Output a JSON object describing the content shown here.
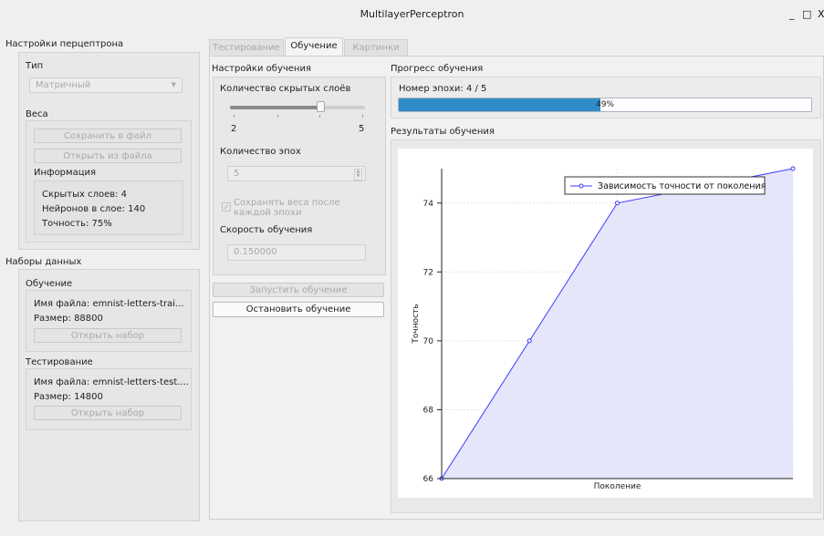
{
  "window": {
    "title": "MultilayerPerceptron",
    "minimize": "_",
    "maximize": "□",
    "close": "X"
  },
  "perceptron_settings": {
    "group_title": "Настройки перцептрона",
    "type_label": "Тип",
    "type_value": "Матричный",
    "weights_label": "Веса",
    "save_button": "Сохранить в файл",
    "open_button": "Открыть из файла",
    "info_label": "Информация",
    "hidden_layers": "Скрытых слоев:  4",
    "neurons": "Нейронов в слое:  140",
    "accuracy": "Точность:  75%"
  },
  "datasets": {
    "group_title": "Наборы данных",
    "training": {
      "label": "Обучение",
      "file": "Имя файла:  emnist-letters-trai...",
      "size": "Размер:  88800",
      "open_button": "Открыть набор"
    },
    "testing": {
      "label": "Тестирование",
      "file": "Имя файла:  emnist-letters-test....",
      "size": "Размер:  14800",
      "open_button": "Открыть набор"
    }
  },
  "tabs": [
    "Тестирование",
    "Обучение",
    "Картинки"
  ],
  "training_settings": {
    "title": "Настройки обучения",
    "hidden_layers_label": "Количество скрытых слоёв",
    "slider_min": "2",
    "slider_max": "5",
    "slider_value": 4,
    "epochs_label": "Количество эпох",
    "epochs_value": "5",
    "save_weights_label": "Сохранять веса после каждой эпохи",
    "learning_rate_label": "Скорость обучения",
    "learning_rate_value": "0.150000",
    "start_button": "Запустить обучение",
    "stop_button": "Остановить обучение"
  },
  "progress": {
    "title": "Прогресс обучения",
    "epoch_text": "Номер эпохи:  4 / 5",
    "percent_text": "49%",
    "percent_value": 49,
    "fill_color": "#308cc6"
  },
  "results": {
    "title": "Результаты обучения"
  },
  "chart_data": {
    "type": "area",
    "x": [
      1,
      2,
      3,
      4,
      5
    ],
    "series": [
      {
        "name": "Зависимость точности от поколения",
        "values": [
          66,
          70,
          74,
          74.5,
          75
        ],
        "color": "#3b3bff",
        "fill": "#e6e6fb"
      }
    ],
    "xlabel": "Поколение",
    "ylabel": "Точность",
    "yticks": [
      66,
      68,
      70,
      72,
      74
    ],
    "xlim": [
      1,
      5
    ],
    "ylim": [
      66,
      75
    ],
    "grid": true,
    "legend": "top-right"
  }
}
